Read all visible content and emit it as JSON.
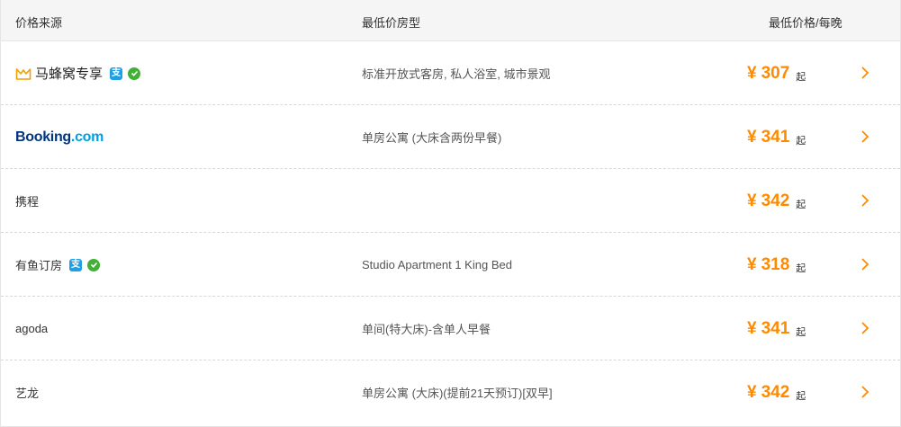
{
  "header": {
    "source_label": "价格来源",
    "room_label": "最低价房型",
    "price_label": "最低价格/每晚"
  },
  "rows": [
    {
      "source": "马蜂窝专享",
      "source_type": "mafengwo",
      "pay_icons": [
        "alipay-icon",
        "wechat-pay-icon"
      ],
      "room": "标准开放式客房, 私人浴室, 城市景观",
      "currency": "¥",
      "price": "307",
      "suffix": "起"
    },
    {
      "source": "Booking",
      "source_dot": ".",
      "source_suffix": "com",
      "source_type": "booking",
      "pay_icons": [],
      "room": "单房公寓 (大床含两份早餐)",
      "currency": "¥",
      "price": "341",
      "suffix": "起"
    },
    {
      "source": "携程",
      "source_type": "text",
      "pay_icons": [],
      "room": "",
      "currency": "¥",
      "price": "342",
      "suffix": "起"
    },
    {
      "source": "有鱼订房",
      "source_type": "text",
      "pay_icons": [
        "alipay-icon",
        "wechat-pay-icon"
      ],
      "room": "Studio Apartment 1 King Bed",
      "currency": "¥",
      "price": "318",
      "suffix": "起"
    },
    {
      "source": "agoda",
      "source_type": "text",
      "pay_icons": [],
      "room": "单间(特大床)-含单人早餐",
      "currency": "¥",
      "price": "341",
      "suffix": "起"
    },
    {
      "source": "艺龙",
      "source_type": "text",
      "pay_icons": [],
      "room": "单房公寓 (大床)(提前21天预订)[双早]",
      "currency": "¥",
      "price": "342",
      "suffix": "起"
    }
  ],
  "icons": {
    "alipay_glyph": "支"
  },
  "colors": {
    "price": "#ff8a00",
    "arrow": "#ff8a00",
    "alipay": "#1ea0e8",
    "wechat": "#41b035",
    "booking_primary": "#003580",
    "booking_accent": "#009fe3"
  }
}
